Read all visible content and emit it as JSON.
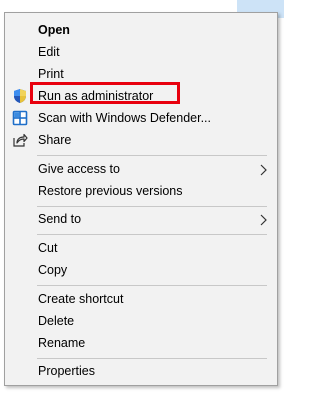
{
  "context_menu": {
    "items": [
      {
        "label": "Open"
      },
      {
        "label": "Edit"
      },
      {
        "label": "Print"
      },
      {
        "label": "Run as administrator"
      },
      {
        "label": "Scan with Windows Defender..."
      },
      {
        "label": "Share"
      },
      {
        "label": "Give access to"
      },
      {
        "label": "Restore previous versions"
      },
      {
        "label": "Send to"
      },
      {
        "label": "Cut"
      },
      {
        "label": "Copy"
      },
      {
        "label": "Create shortcut"
      },
      {
        "label": "Delete"
      },
      {
        "label": "Rename"
      },
      {
        "label": "Properties"
      }
    ]
  },
  "icons": {
    "run_as_admin": "uac-shield-icon",
    "scan": "windows-defender-icon",
    "share": "share-icon",
    "submenu": "chevron-right-icon"
  },
  "colors": {
    "highlight_border": "#e8000e",
    "menu_background": "#f2f2f2",
    "separator": "#c8c8c8"
  }
}
